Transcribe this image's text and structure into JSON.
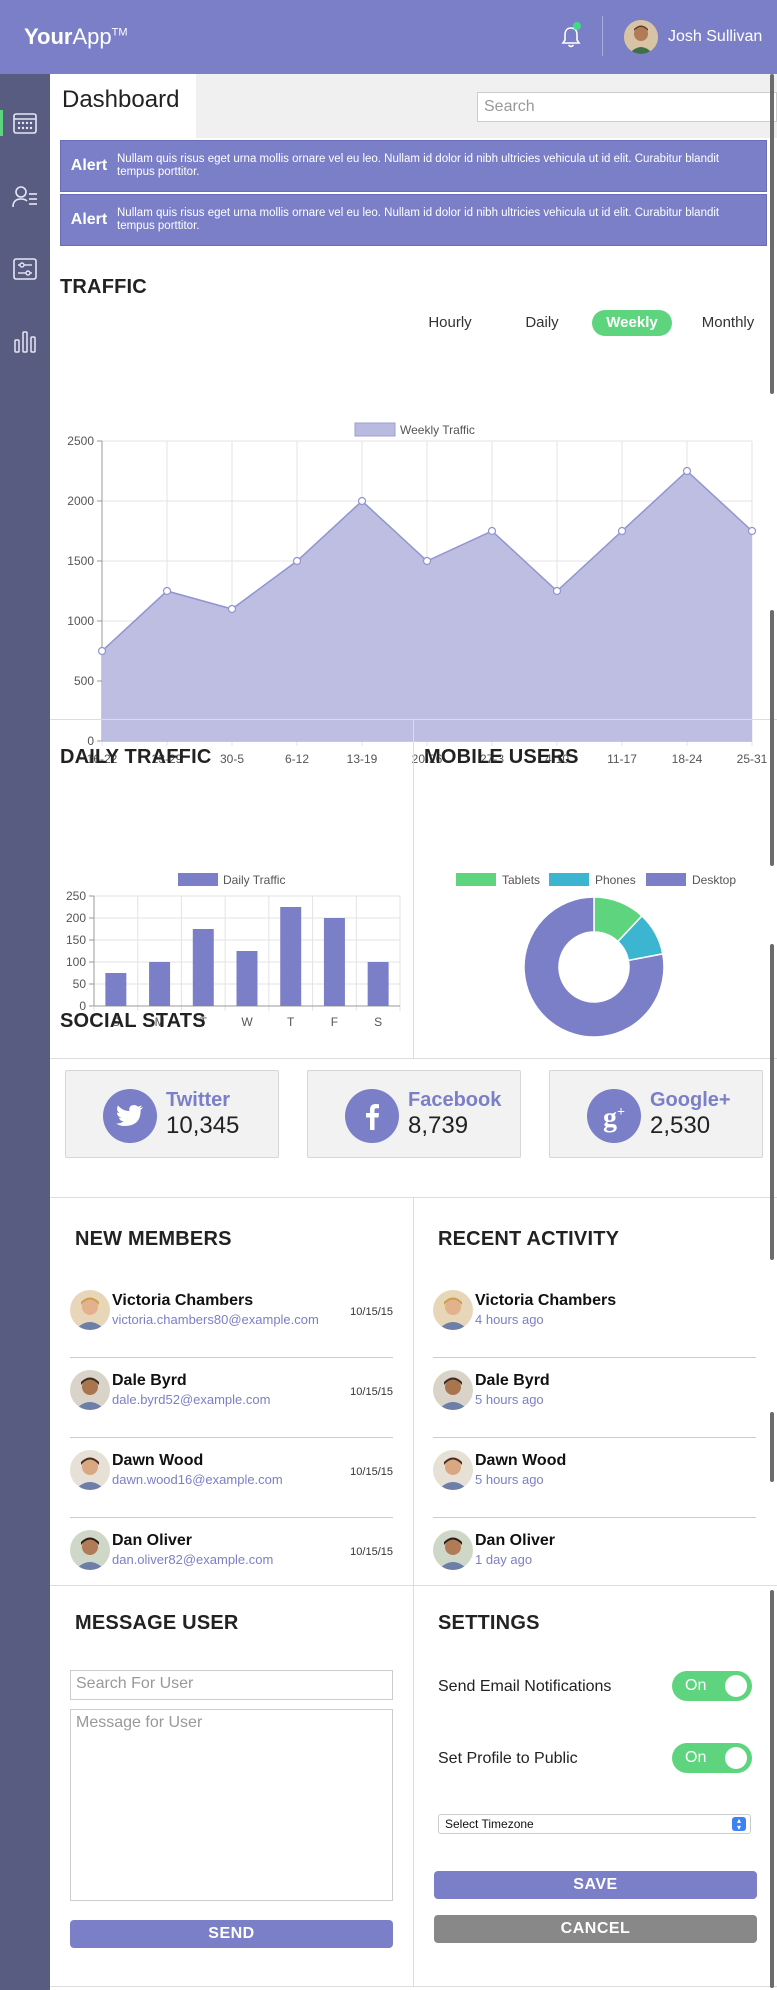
{
  "header": {
    "brand_bold": "Your",
    "brand_light": "App",
    "brand_mark": "TM",
    "user_name": "Josh Sullivan"
  },
  "sidebar": {
    "items": [
      {
        "icon": "calendar-icon"
      },
      {
        "icon": "members-icon"
      },
      {
        "icon": "settings-sliders-icon"
      },
      {
        "icon": "bar-chart-icon"
      }
    ]
  },
  "topbar": {
    "page_title": "Dashboard",
    "search_placeholder": "Search"
  },
  "alerts": [
    {
      "label": "Alert",
      "text": "Nullam quis risus eget urna mollis ornare vel eu leo. Nullam id dolor id nibh ultricies vehicula ut id elit. Curabitur blandit tempus porttitor."
    },
    {
      "label": "Alert",
      "text": "Nullam quis risus eget urna mollis ornare vel eu leo. Nullam id dolor id nibh ultricies vehicula ut id elit. Curabitur blandit tempus porttitor."
    }
  ],
  "traffic": {
    "title": "TRAFFIC",
    "tabs": [
      "Hourly",
      "Daily",
      "Weekly",
      "Monthly"
    ],
    "active_tab": "Weekly"
  },
  "daily_traffic": {
    "title": "DAILY TRAFFIC"
  },
  "mobile_users": {
    "title": "MOBILE USERS"
  },
  "chart_data": [
    {
      "type": "area",
      "title": "",
      "legend": [
        "Weekly Traffic"
      ],
      "legend_position": "top",
      "categories": [
        "16-22",
        "23-29",
        "30-5",
        "6-12",
        "13-19",
        "20-26",
        "27-3",
        "4-10",
        "11-17",
        "18-24",
        "25-31"
      ],
      "series": [
        {
          "name": "Weekly Traffic",
          "values": [
            750,
            1250,
            1100,
            1500,
            2000,
            1500,
            1750,
            1250,
            1750,
            2250,
            1750
          ]
        }
      ],
      "ylim": [
        0,
        2500
      ],
      "yticks": [
        0,
        500,
        1000,
        1500,
        2000,
        2500
      ],
      "grid": true,
      "color": "#b9bae0"
    },
    {
      "type": "bar",
      "title": "",
      "legend": [
        "Daily Traffic"
      ],
      "legend_position": "top",
      "categories": [
        "S",
        "M",
        "T",
        "W",
        "T",
        "F",
        "S"
      ],
      "series": [
        {
          "name": "Daily Traffic",
          "values": [
            75,
            100,
            175,
            125,
            225,
            200,
            100
          ]
        }
      ],
      "ylim": [
        0,
        250
      ],
      "yticks": [
        0,
        50,
        100,
        150,
        200,
        250
      ],
      "grid": true,
      "color": "#7b7fc7"
    },
    {
      "type": "pie",
      "title": "",
      "legend": [
        "Tablets",
        "Phones",
        "Desktop"
      ],
      "legend_position": "top",
      "series": [
        {
          "name": "Mobile Users",
          "values": [
            12,
            10,
            78
          ]
        }
      ],
      "colors": [
        "#5fd47f",
        "#3bb5d0",
        "#7b7fc7"
      ]
    }
  ],
  "social": {
    "title": "SOCIAL STATS",
    "cards": [
      {
        "name": "Twitter",
        "count": "10,345",
        "icon": "twitter-icon"
      },
      {
        "name": "Facebook",
        "count": "8,739",
        "icon": "facebook-icon"
      },
      {
        "name": "Google+",
        "count": "2,530",
        "icon": "google-plus-icon"
      }
    ]
  },
  "new_members": {
    "title": "NEW MEMBERS",
    "items": [
      {
        "name": "Victoria Chambers",
        "email": "victoria.chambers80@example.com",
        "date": "10/15/15"
      },
      {
        "name": "Dale Byrd",
        "email": "dale.byrd52@example.com",
        "date": "10/15/15"
      },
      {
        "name": "Dawn Wood",
        "email": "dawn.wood16@example.com",
        "date": "10/15/15"
      },
      {
        "name": "Dan Oliver",
        "email": "dan.oliver82@example.com",
        "date": "10/15/15"
      }
    ]
  },
  "recent_activity": {
    "title": "RECENT ACTIVITY",
    "items": [
      {
        "name": "Victoria Chambers",
        "time": "4 hours ago"
      },
      {
        "name": "Dale Byrd",
        "time": "5 hours ago"
      },
      {
        "name": "Dawn Wood",
        "time": "5 hours ago"
      },
      {
        "name": "Dan Oliver",
        "time": "1 day ago"
      }
    ]
  },
  "message_user": {
    "title": "MESSAGE USER",
    "search_placeholder": "Search For User",
    "message_placeholder": "Message for User",
    "send_label": "SEND"
  },
  "settings": {
    "title": "SETTINGS",
    "email_label": "Send Email Notifications",
    "email_toggle": "On",
    "profile_label": "Set Profile to Public",
    "profile_toggle": "On",
    "timezone_label": "Select Timezone",
    "save_label": "SAVE",
    "cancel_label": "CANCEL"
  },
  "colors": {
    "accent": "#7b7fc7",
    "success": "#5fd47f",
    "sidebar": "#595c81",
    "cancel": "#888888"
  }
}
